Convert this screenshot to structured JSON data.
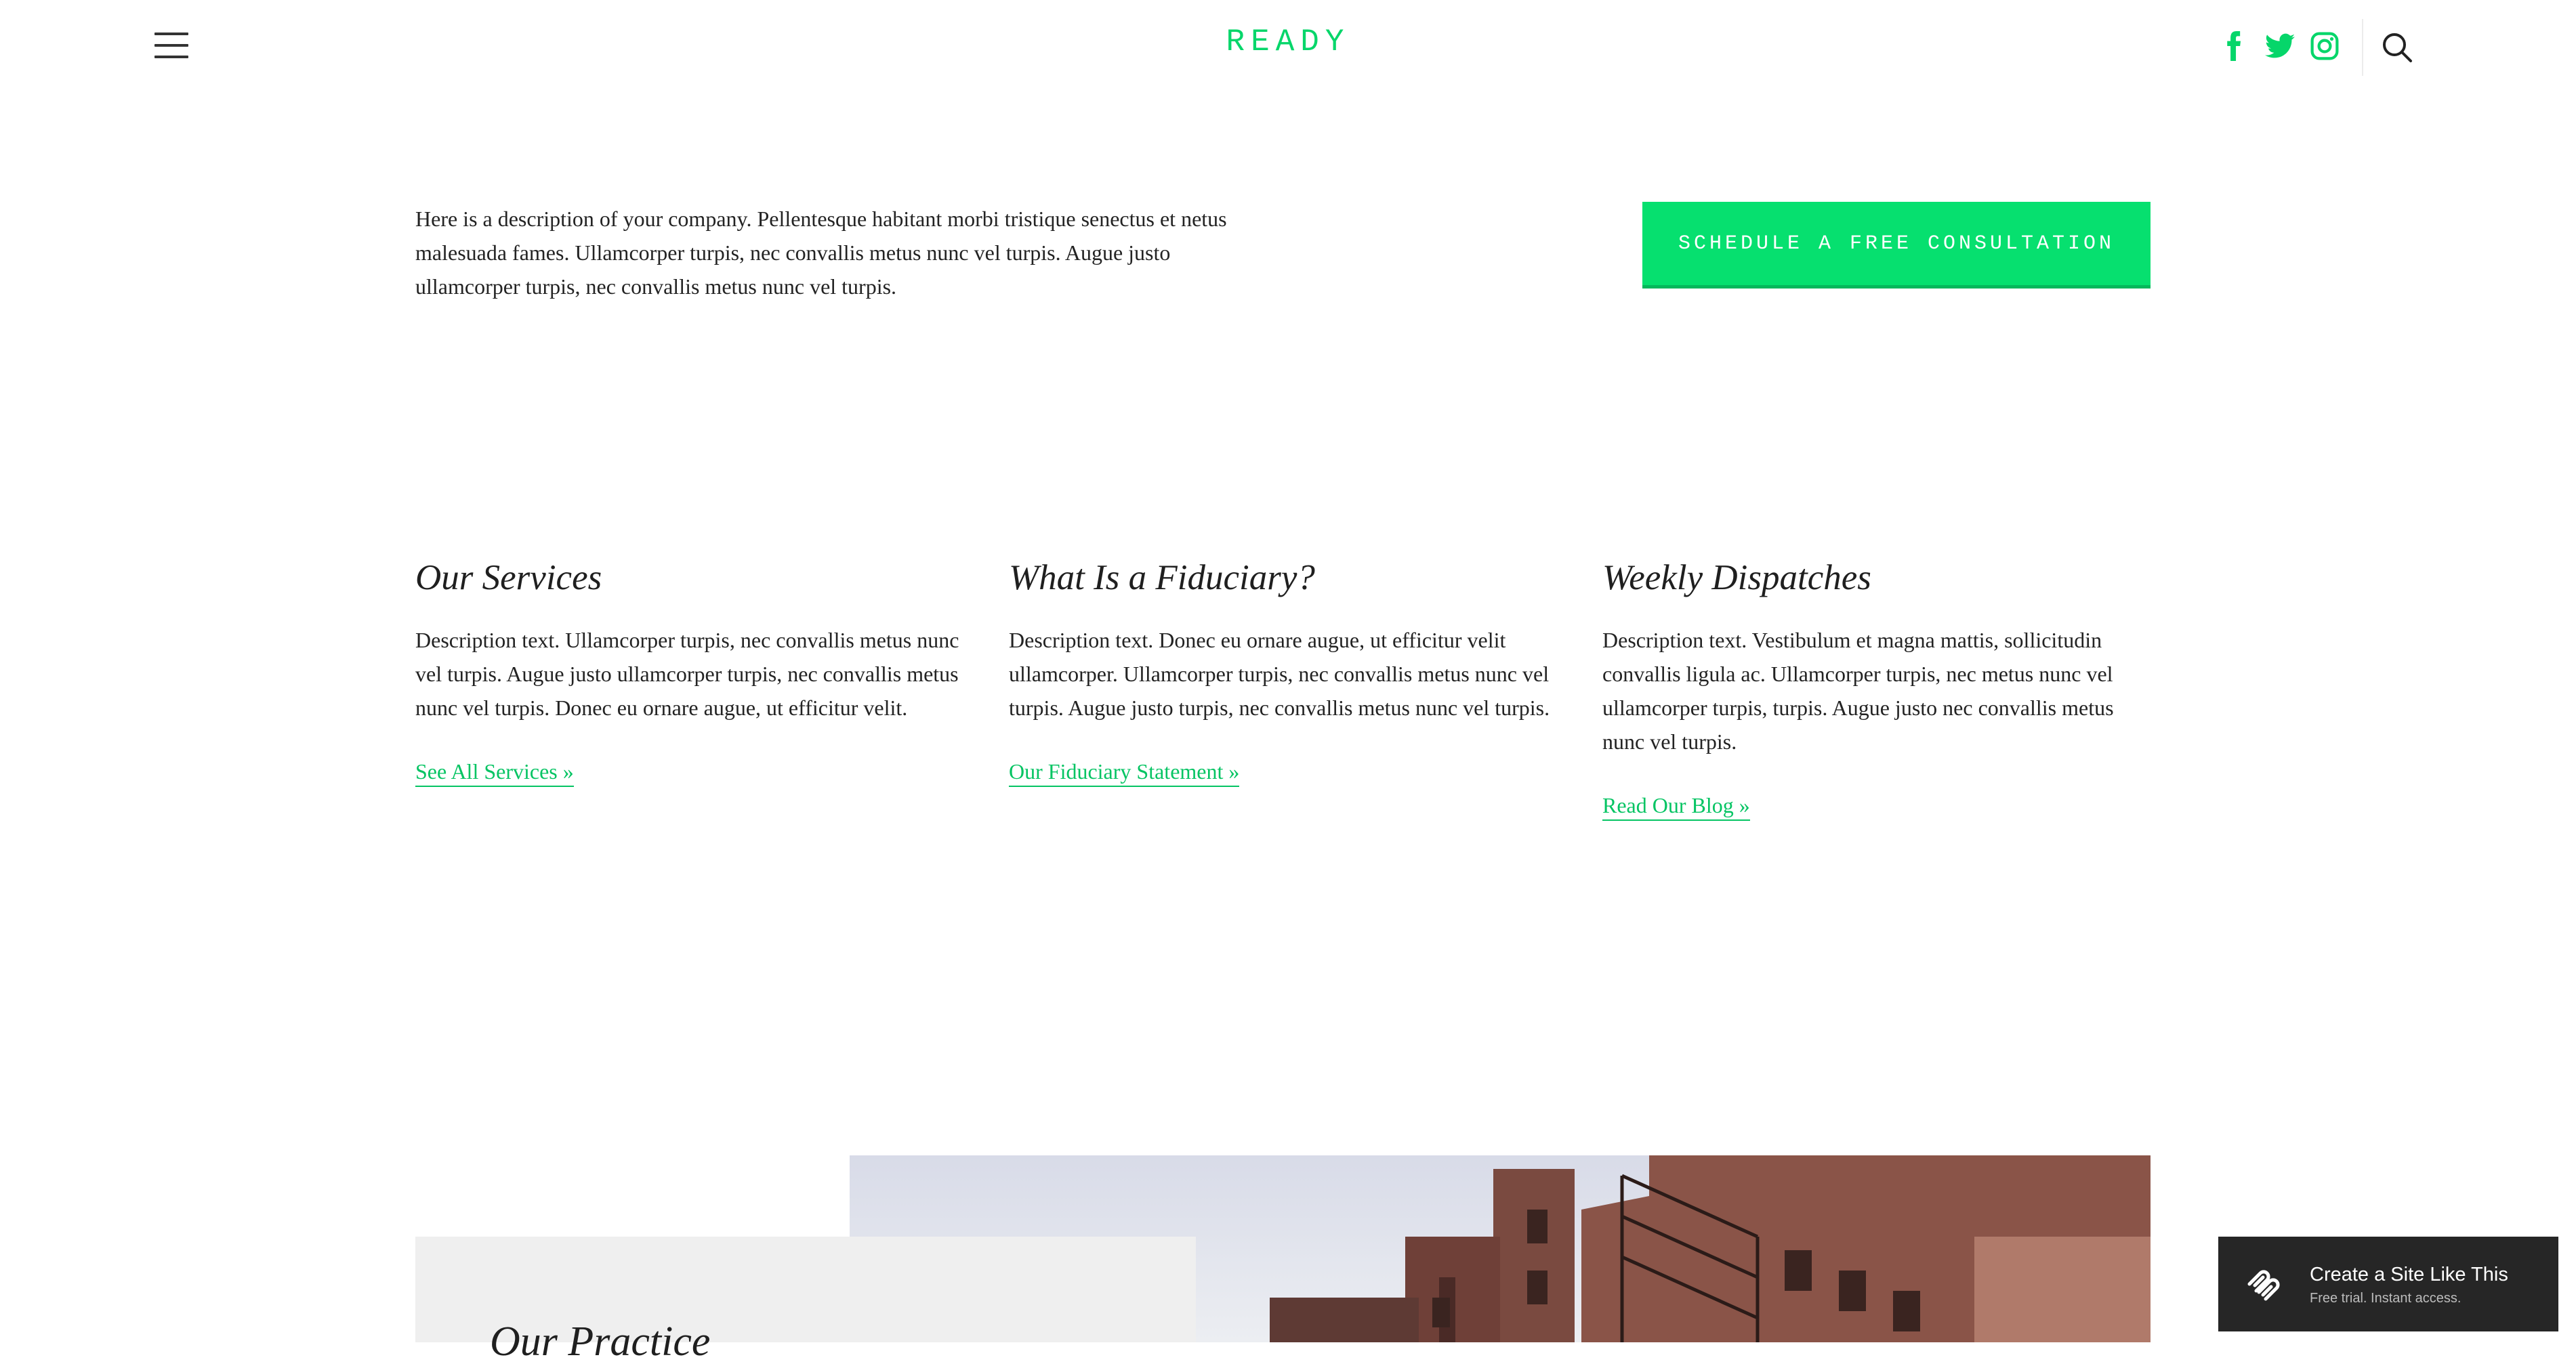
{
  "header": {
    "menu_icon": "hamburger-menu-icon",
    "logo_text": "READY",
    "social": [
      "facebook-icon",
      "twitter-icon",
      "instagram-icon"
    ],
    "search_icon": "search-icon"
  },
  "intro": {
    "description": "Here is a description of your company. Pellentesque habitant morbi tristique senectus et netus malesuada fames. Ullamcorper turpis, nec convallis metus nunc vel turpis. Augue justo ullamcorper turpis, nec convallis metus nunc vel turpis.",
    "cta_label": "SCHEDULE A FREE CONSULTATION"
  },
  "columns": [
    {
      "title": "Our Services",
      "text": "Description text. Ullamcorper turpis, nec convallis metus nunc vel turpis. Augue justo ullamcorper turpis, nec convallis metus nunc vel turpis. Donec eu ornare augue, ut efficitur velit.",
      "link": "See All Services »"
    },
    {
      "title": "What Is a Fiduciary?",
      "text": "Description text. Donec eu ornare augue, ut efficitur velit ullamcorper. Ullamcorper turpis, nec convallis metus nunc vel turpis. Augue justo turpis, nec convallis metus nunc vel turpis.",
      "link": "Our Fiduciary Statement »"
    },
    {
      "title": "Weekly Dispatches",
      "text": "Description text. Vestibulum et magna mattis, sollicitudin convallis ligula ac. Ullamcorper turpis, nec metus nunc vel ullamcorper turpis, turpis. Augue justo nec convallis metus nunc vel turpis.",
      "link": "Read Our Blog »"
    }
  ],
  "bottom": {
    "box_title": "Our Practice"
  },
  "badge": {
    "title": "Create a Site Like This",
    "subtitle": "Free trial. Instant access."
  },
  "colors": {
    "accent": "#06d66a",
    "button": "#06e06f",
    "badge_bg": "#262626"
  }
}
